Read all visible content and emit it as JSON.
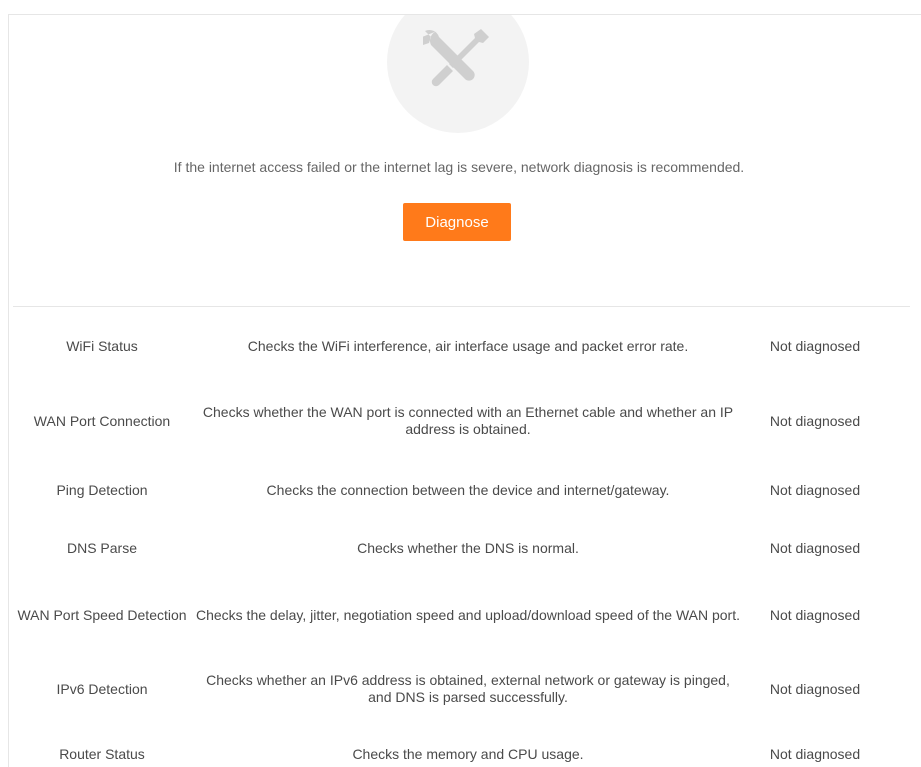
{
  "hint": "If the internet access failed or the internet lag is severe, network diagnosis is recommended.",
  "diagnose_label": "Diagnose",
  "rows": [
    {
      "name": "WiFi Status",
      "desc": "Checks the WiFi interference, air interface usage and packet error rate.",
      "status": "Not diagnosed"
    },
    {
      "name": "WAN Port Connection",
      "desc": "Checks whether the WAN port is connected with an Ethernet cable and whether an IP address is obtained.",
      "status": "Not diagnosed"
    },
    {
      "name": "Ping Detection",
      "desc": "Checks the connection between the device and internet/gateway.",
      "status": "Not diagnosed"
    },
    {
      "name": "DNS Parse",
      "desc": "Checks whether the DNS is normal.",
      "status": "Not diagnosed"
    },
    {
      "name": "WAN Port Speed Detection",
      "desc": "Checks the delay, jitter, negotiation speed and upload/download speed of the WAN port.",
      "status": "Not diagnosed"
    },
    {
      "name": "IPv6 Detection",
      "desc": "Checks whether an IPv6 address is obtained, external network or gateway is pinged, and DNS is parsed successfully.",
      "status": "Not diagnosed"
    },
    {
      "name": "Router Status",
      "desc": "Checks the memory and CPU usage.",
      "status": "Not diagnosed"
    }
  ],
  "icons": {
    "diagnosis": "tools-icon"
  },
  "colors": {
    "accent": "#ff7a1a"
  }
}
